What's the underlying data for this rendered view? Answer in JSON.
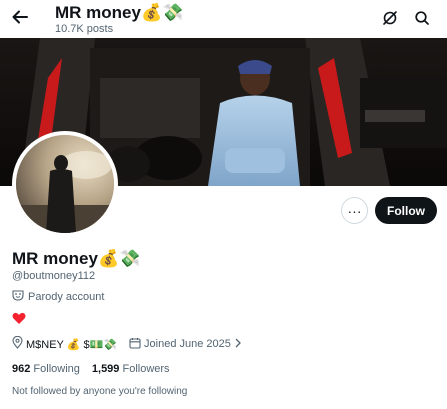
{
  "header": {
    "title": "MR money💰💸",
    "posts_count": "10.7K posts"
  },
  "profile": {
    "name": "MR money💰💸",
    "handle": "@boutmoney112",
    "parody_label": "Parody account",
    "bio": "❤️",
    "location": "M$NEY 💰 $💵💸",
    "joined": "Joined June 2025",
    "following_count": "962",
    "following_label": "Following",
    "followers_count": "1,599",
    "followers_label": "Followers",
    "followed_by": "Not followed by anyone you're following"
  },
  "actions": {
    "follow_label": "Follow",
    "more_label": "···"
  },
  "icons": {
    "back": "back-arrow-icon",
    "grok": "grok-icon",
    "search": "search-icon",
    "parody": "parody-mask-icon",
    "location": "location-pin-icon",
    "calendar": "calendar-icon",
    "chevron": "chevron-right-icon"
  },
  "colors": {
    "follow_button": "#0f1419",
    "secondary_text": "#536471",
    "heart": "#f4212e"
  }
}
